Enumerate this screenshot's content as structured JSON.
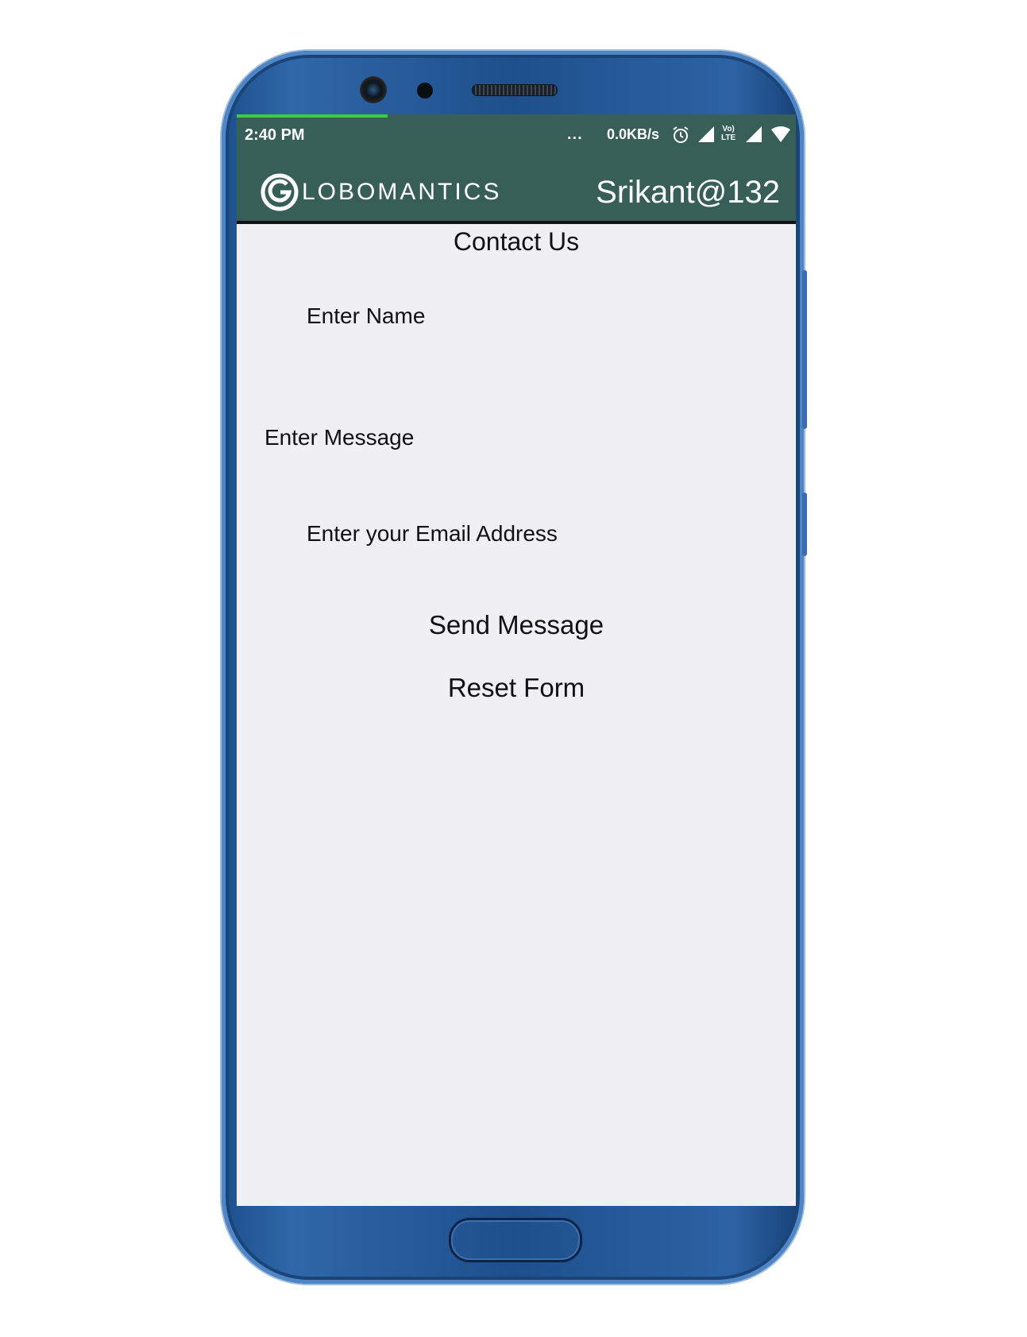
{
  "status_bar": {
    "time": "2:40 PM",
    "dots": "...",
    "network_speed": "0.0KB/s",
    "icons": [
      "alarm-icon",
      "signal-icon",
      "volte-icon",
      "signal-icon",
      "wifi-icon"
    ],
    "volte_label_top": "Vo)",
    "volte_label_bottom": "LTE",
    "load_progress": 0.27
  },
  "app_bar": {
    "logo_letter": "G",
    "logo_text": "LOBOMANTICS",
    "username": "Srikant@132"
  },
  "page": {
    "title": "Contact Us",
    "name_placeholder": "Enter Name",
    "message_placeholder": "Enter Message",
    "email_placeholder": "Enter your Email Address",
    "send_button": "Send Message",
    "reset_button": "Reset Form"
  },
  "colors": {
    "app_bar": "#375f58",
    "screen_bg": "#efeff4",
    "phone_body": "#1e4f8c",
    "progress": "#3dcf3d"
  }
}
